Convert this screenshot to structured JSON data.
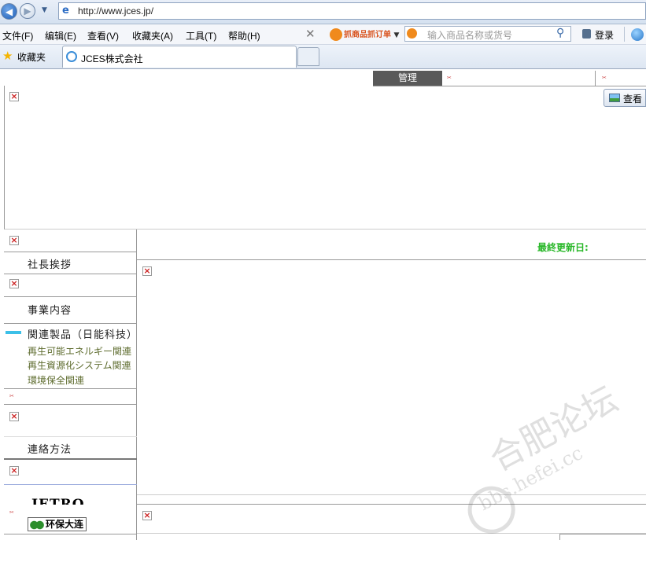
{
  "browser": {
    "url": "http://www.jces.jp/",
    "menus": [
      "文件(F)",
      "编辑(E)",
      "查看(V)",
      "收藏夹(A)",
      "工具(T)",
      "帮助(H)"
    ],
    "toolbar_logo": "抓商品抓订单",
    "search_placeholder": "输入商品名称或货号",
    "login_label": "登录",
    "favorites_label": "收藏夹",
    "tab_title": "JCES株式会社"
  },
  "page": {
    "admin_tab": "管理",
    "view_button": "查看",
    "sidebar": {
      "greeting": "社長挨拶",
      "business": "事業内容",
      "related_products": "関連製品（日能科技）",
      "sub_links": [
        "再生可能エネルギー関連",
        "再生資源化システム関連",
        "環境保全関連"
      ],
      "contact": "連絡方法"
    },
    "last_updated_label": "最終更新日:",
    "jetro_logo": "JETRO",
    "eco_badge": "环保大连"
  },
  "watermark": {
    "main": "合肥论坛",
    "sub": "bbs.hefei.cc"
  }
}
